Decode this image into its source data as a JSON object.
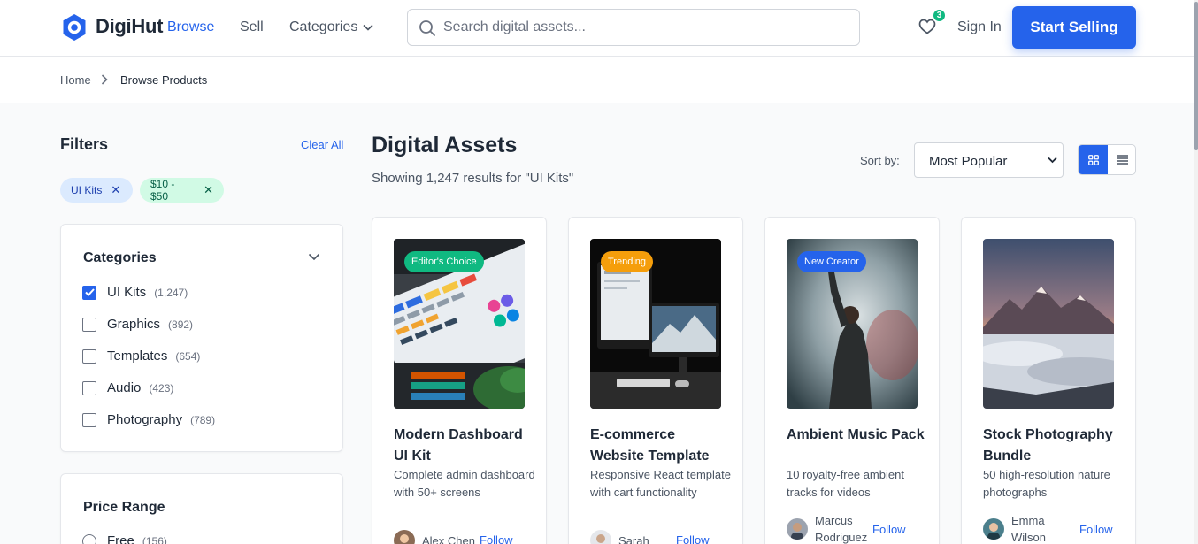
{
  "header": {
    "brand": "DigiHut",
    "nav": {
      "browse": "Browse",
      "sell": "Sell",
      "categories": "Categories"
    },
    "search_placeholder": "Search digital assets...",
    "wishlist_count": "3",
    "sign_in": "Sign In",
    "cta": "Start Selling"
  },
  "breadcrumb": {
    "home": "Home",
    "current": "Browse Products"
  },
  "filters": {
    "title": "Filters",
    "clear_all": "Clear All",
    "chips": [
      {
        "label": "UI Kits",
        "color": "#dbeafe"
      },
      {
        "label": "$10 - $50",
        "color": "#d1fae5"
      }
    ],
    "categories": {
      "title": "Categories",
      "items": [
        {
          "label": "UI Kits",
          "count": "(1,247)",
          "checked": true
        },
        {
          "label": "Graphics",
          "count": "(892)",
          "checked": false
        },
        {
          "label": "Templates",
          "count": "(654)",
          "checked": false
        },
        {
          "label": "Audio",
          "count": "(423)",
          "checked": false
        },
        {
          "label": "Photography",
          "count": "(789)",
          "checked": false
        }
      ]
    },
    "price": {
      "title": "Price Range",
      "options": [
        {
          "label": "Free",
          "count": "(156)"
        }
      ]
    }
  },
  "main": {
    "title": "Digital Assets",
    "results": "Showing 1,247 results for \"UI Kits\"",
    "sort_label": "Sort by:",
    "sort_value": "Most Popular",
    "products": [
      {
        "badge": "Editor's Choice",
        "badge_color": "#10b981",
        "title": "Modern Dashboard UI Kit",
        "desc": "Complete admin dashboard with 50+ screens",
        "author": "Alex Chen",
        "follow": "Follow"
      },
      {
        "badge": "Trending",
        "badge_color": "#f59e0b",
        "title": "E-commerce Website Template",
        "desc": "Responsive React template with cart functionality",
        "author": "Sarah",
        "follow": "Follow"
      },
      {
        "badge": "New Creator",
        "badge_color": "#2563eb",
        "title": "Ambient Music Pack",
        "desc": "10 royalty-free ambient tracks for videos",
        "author": "Marcus Rodriguez",
        "follow": "Follow"
      },
      {
        "badge": "",
        "badge_color": "",
        "title": "Stock Photography Bundle",
        "desc": "50 high-resolution nature photographs",
        "author": "Emma Wilson",
        "follow": "Follow"
      }
    ]
  },
  "colors": {
    "primary": "#2563eb",
    "success": "#10b981",
    "warning": "#f59e0b",
    "text": "#1f2937"
  }
}
